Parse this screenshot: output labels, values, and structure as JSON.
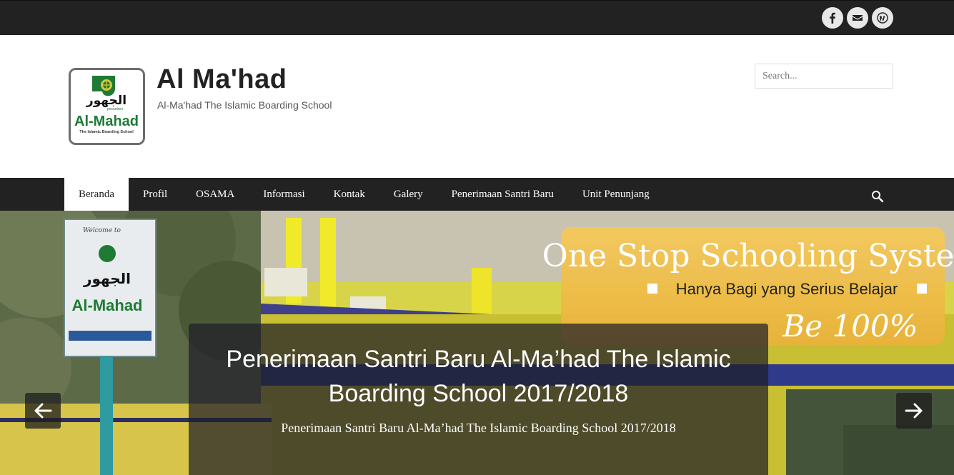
{
  "topbar": {
    "social": [
      {
        "icon": "facebook-icon",
        "glyph": "f"
      },
      {
        "icon": "email-icon",
        "glyph": "✉"
      },
      {
        "icon": "wordpress-icon",
        "glyph": "W"
      }
    ]
  },
  "header": {
    "site_title": "Al Ma'had",
    "site_description": "Al-Ma'had The Islamic Boarding School",
    "logo": {
      "arabic": "الجهور",
      "sub": "pesantren",
      "name": "Al-Mahad",
      "tagline": "The Islamic Boarding School"
    },
    "search_placeholder": "Search..."
  },
  "nav": {
    "items": [
      {
        "label": "Beranda",
        "active": true
      },
      {
        "label": "Profil",
        "active": false
      },
      {
        "label": "OSAMA",
        "active": false
      },
      {
        "label": "Informasi",
        "active": false
      },
      {
        "label": "Kontak",
        "active": false
      },
      {
        "label": "Galery",
        "active": false
      },
      {
        "label": "Penerimaan Santri Baru",
        "active": false
      },
      {
        "label": "Unit Penunjang",
        "active": false
      }
    ]
  },
  "slider": {
    "banner_line1": "One Stop Schooling System",
    "banner_line2": "Hanya Bagi yang Serius Belajar",
    "banner_line3": "Be 100%",
    "sign_welcome": "Welcome to",
    "sign_name": "Al-Mahad",
    "caption_title": "Penerimaan Santri Baru Al-Ma’had The Islamic Boarding School 2017/2018",
    "caption_text": "Penerimaan Santri Baru Al-Ma’had The Islamic Boarding School 2017/2018"
  },
  "colors": {
    "topbar": "#222222",
    "nav": "#222222",
    "banner": "#f2c24a",
    "building_yellow": "#e3d11a"
  }
}
